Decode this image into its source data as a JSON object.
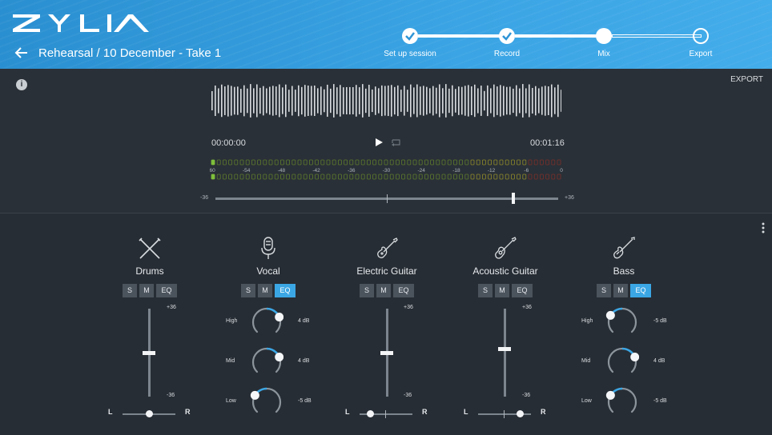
{
  "app": {
    "logo_text": "ZYLIA"
  },
  "header": {
    "back_label": "←",
    "session_title": "Rehearsal / 10 December - Take 1",
    "steps": [
      {
        "label": "Set up session",
        "state": "done"
      },
      {
        "label": "Record",
        "state": "done"
      },
      {
        "label": "Mix",
        "state": "current"
      },
      {
        "label": "Export",
        "state": "pending"
      }
    ]
  },
  "transport": {
    "export_label": "EXPORT",
    "info_label": "i",
    "time_current": "00:00:00",
    "time_total": "00:01:16",
    "meter_scale": [
      "-60",
      "-54",
      "-48",
      "-42",
      "-36",
      "-30",
      "-24",
      "-18",
      "-12",
      "-6",
      "0"
    ],
    "master_min_label": "-36",
    "master_max_label": "+36",
    "master_value_fraction": 0.87
  },
  "colors": {
    "accent": "#3ba6e4",
    "header": "#2f95d6",
    "background": "#272d34",
    "meter_green": "#7fbf3a",
    "meter_yellow": "#d7c43a",
    "meter_red": "#c0392b"
  },
  "channels": [
    {
      "name": "Drums",
      "icon": "drums-icon",
      "solo": "S",
      "mute": "M",
      "eq": "EQ",
      "eq_active": false,
      "fader_max": "+36",
      "fader_min": "-36",
      "fader_level": 0.5,
      "pan_l": "L",
      "pan_r": "R",
      "pan_value": 0.5
    },
    {
      "name": "Vocal",
      "icon": "microphone-icon",
      "solo": "S",
      "mute": "M",
      "eq": "EQ",
      "eq_active": true,
      "eq_bands": [
        {
          "label": "High",
          "value": "4 dB",
          "level": 0.75
        },
        {
          "label": "Mid",
          "value": "4 dB",
          "level": 0.75
        },
        {
          "label": "Low",
          "value": "-5 dB",
          "level": 0.28
        }
      ]
    },
    {
      "name": "Electric Guitar",
      "icon": "electric-guitar-icon",
      "solo": "S",
      "mute": "M",
      "eq": "EQ",
      "eq_active": false,
      "fader_max": "+36",
      "fader_min": "-36",
      "fader_level": 0.5,
      "pan_l": "L",
      "pan_r": "R",
      "pan_value": 0.2
    },
    {
      "name": "Acoustic Guitar",
      "icon": "acoustic-guitar-icon",
      "solo": "S",
      "mute": "M",
      "eq": "EQ",
      "eq_active": false,
      "fader_max": "+36",
      "fader_min": "-36",
      "fader_level": 0.55,
      "pan_l": "L",
      "pan_r": "R",
      "pan_value": 0.8
    },
    {
      "name": "Bass",
      "icon": "bass-guitar-icon",
      "solo": "S",
      "mute": "M",
      "eq": "EQ",
      "eq_active": true,
      "eq_bands": [
        {
          "label": "High",
          "value": "-5 dB",
          "level": 0.28
        },
        {
          "label": "Mid",
          "value": "4 dB",
          "level": 0.75
        },
        {
          "label": "Low",
          "value": "-5 dB",
          "level": 0.28
        }
      ]
    }
  ]
}
